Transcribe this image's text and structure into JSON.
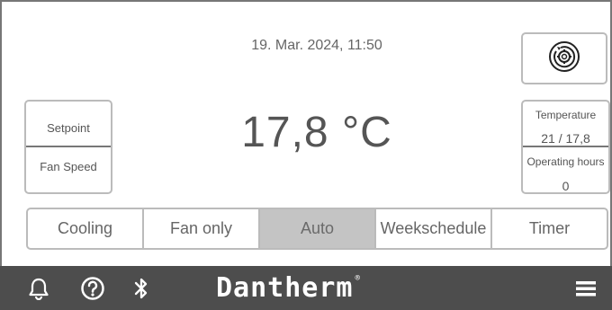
{
  "header": {
    "datetime": "19. Mar. 2024, 11:50"
  },
  "left_panel": {
    "setpoint_label": "Setpoint",
    "fanspeed_label": "Fan Speed"
  },
  "main": {
    "temperature": "17,8 °C"
  },
  "right_panel": {
    "temperature_label": "Temperature",
    "temperature_value": "21 / 17,8",
    "hours_label": "Operating hours",
    "hours_value": "0"
  },
  "modes": [
    {
      "label": "Cooling",
      "active": false
    },
    {
      "label": "Fan only",
      "active": false
    },
    {
      "label": "Auto",
      "active": true
    },
    {
      "label": "Weekschedule",
      "active": false
    },
    {
      "label": "Timer",
      "active": false
    }
  ],
  "bottom_bar": {
    "brand": "Dantherm",
    "brand_mark": "®",
    "icons": [
      "bell-icon",
      "help-icon",
      "bluetooth-icon",
      "menu-icon"
    ]
  },
  "colors": {
    "bar": "#4d4d4d",
    "active_mode": "#c4c4c4",
    "border": "#bbbbbb"
  }
}
